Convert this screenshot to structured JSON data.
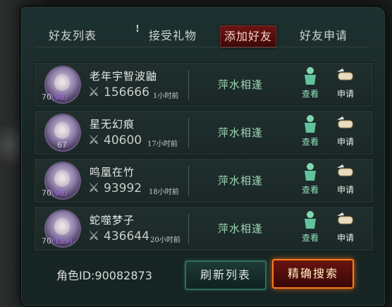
{
  "tabs": [
    {
      "label": "好友列表"
    },
    {
      "label": "接受礼物",
      "alert": "!"
    },
    {
      "label": "添加好友"
    },
    {
      "label": "好友申请"
    }
  ],
  "rows": [
    {
      "level": "70",
      "vip": "(98)",
      "name": "老年宇智波鼬",
      "power": "156666",
      "ago": "1小时前",
      "status": "萍水相逢",
      "view": "查看",
      "apply": "申请"
    },
    {
      "level": "67",
      "vip": "",
      "name": "星无幻痕",
      "power": "40600",
      "ago": "17小时前",
      "status": "萍水相逢",
      "view": "查看",
      "apply": "申请"
    },
    {
      "level": "70",
      "vip": "(98)",
      "name": "鸣凰在竹",
      "power": "93992",
      "ago": "18小时前",
      "status": "萍水相逢",
      "view": "查看",
      "apply": "申请"
    },
    {
      "level": "70",
      "vip": "(159)",
      "name": "蛇噬梦子",
      "power": "436644",
      "ago": "20小时前",
      "status": "萍水相逢",
      "view": "查看",
      "apply": "申请"
    }
  ],
  "footer": {
    "role_id": "角色ID:90082873",
    "refresh_label": "刷新列表",
    "search_label": "精确搜索"
  }
}
